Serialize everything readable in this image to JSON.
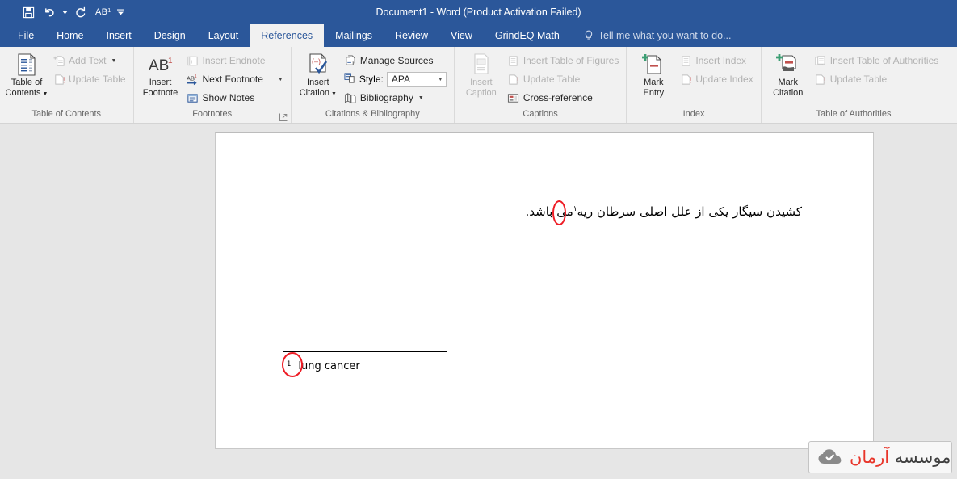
{
  "window": {
    "title": "Document1 - Word (Product Activation Failed)"
  },
  "quick_access": {
    "save_icon": "save-icon",
    "undo_icon": "undo-icon",
    "redo_icon": "redo-icon",
    "footnote_icon_label": "AB",
    "footnote_icon_sup": "1",
    "customize_icon": "customize-quick-access-icon"
  },
  "tabs": [
    {
      "label": "File",
      "active": false
    },
    {
      "label": "Home",
      "active": false
    },
    {
      "label": "Insert",
      "active": false
    },
    {
      "label": "Design",
      "active": false
    },
    {
      "label": "Layout",
      "active": false
    },
    {
      "label": "References",
      "active": true
    },
    {
      "label": "Mailings",
      "active": false
    },
    {
      "label": "Review",
      "active": false
    },
    {
      "label": "View",
      "active": false
    },
    {
      "label": "GrindEQ Math",
      "active": false
    }
  ],
  "tell_me": {
    "placeholder": "Tell me what you want to do...",
    "icon": "lightbulb-icon"
  },
  "ribbon": {
    "groups": [
      {
        "name": "table-of-contents",
        "label": "Table of Contents",
        "big_button": {
          "line1": "Table of",
          "line2": "Contents",
          "has_caret": true,
          "disabled": false
        },
        "small_buttons": [
          {
            "label": "Add Text",
            "has_caret": true,
            "disabled": true
          },
          {
            "label": "Update Table",
            "has_caret": false,
            "disabled": true
          }
        ]
      },
      {
        "name": "footnotes",
        "label": "Footnotes",
        "big_button": {
          "line1": "Insert",
          "line2": "Footnote",
          "has_caret": false,
          "disabled": false
        },
        "small_buttons": [
          {
            "label": "Insert Endnote",
            "has_caret": false,
            "disabled": true
          },
          {
            "label": "Next Footnote",
            "has_caret": true,
            "disabled": false
          },
          {
            "label": "Show Notes",
            "has_caret": false,
            "disabled": false
          }
        ],
        "has_dialog_launcher": true
      },
      {
        "name": "citations-bibliography",
        "label": "Citations & Bibliography",
        "big_button": {
          "line1": "Insert",
          "line2": "Citation",
          "has_caret": true,
          "disabled": false
        },
        "small_buttons": [
          {
            "label": "Manage Sources",
            "has_caret": false,
            "disabled": false
          },
          {
            "label": "Bibliography",
            "has_caret": true,
            "disabled": false
          }
        ],
        "style": {
          "label": "Style:",
          "value": "APA"
        }
      },
      {
        "name": "captions",
        "label": "Captions",
        "big_button": {
          "line1": "Insert",
          "line2": "Caption",
          "has_caret": false,
          "disabled": true
        },
        "small_buttons": [
          {
            "label": "Insert Table of Figures",
            "has_caret": false,
            "disabled": true
          },
          {
            "label": "Update Table",
            "has_caret": false,
            "disabled": true
          },
          {
            "label": "Cross-reference",
            "has_caret": false,
            "disabled": false
          }
        ]
      },
      {
        "name": "index",
        "label": "Index",
        "big_button": {
          "line1": "Mark",
          "line2": "Entry",
          "has_caret": false,
          "disabled": false
        },
        "small_buttons": [
          {
            "label": "Insert Index",
            "has_caret": false,
            "disabled": true
          },
          {
            "label": "Update Index",
            "has_caret": false,
            "disabled": true
          }
        ]
      },
      {
        "name": "table-of-authorities",
        "label": "Table of Authorities",
        "big_button": {
          "line1": "Mark",
          "line2": "Citation",
          "has_caret": false,
          "disabled": false
        },
        "small_buttons": [
          {
            "label": "Insert Table of Authorities",
            "has_caret": false,
            "disabled": true
          },
          {
            "label": "Update Table",
            "has_caret": false,
            "disabled": true
          }
        ]
      }
    ]
  },
  "document": {
    "body_text": "کشیدن سیگار یکی از علل اصلی سرطان ریه",
    "body_text_tail": "می باشد.",
    "footnote_reference": "۱",
    "footnote_number": "1",
    "footnote_text": "lung cancer",
    "annotation_color": "#ee1c25"
  },
  "logo": {
    "text_main": "موسسه",
    "text_accent": "آرمان",
    "icon": "cloud-check-icon"
  }
}
